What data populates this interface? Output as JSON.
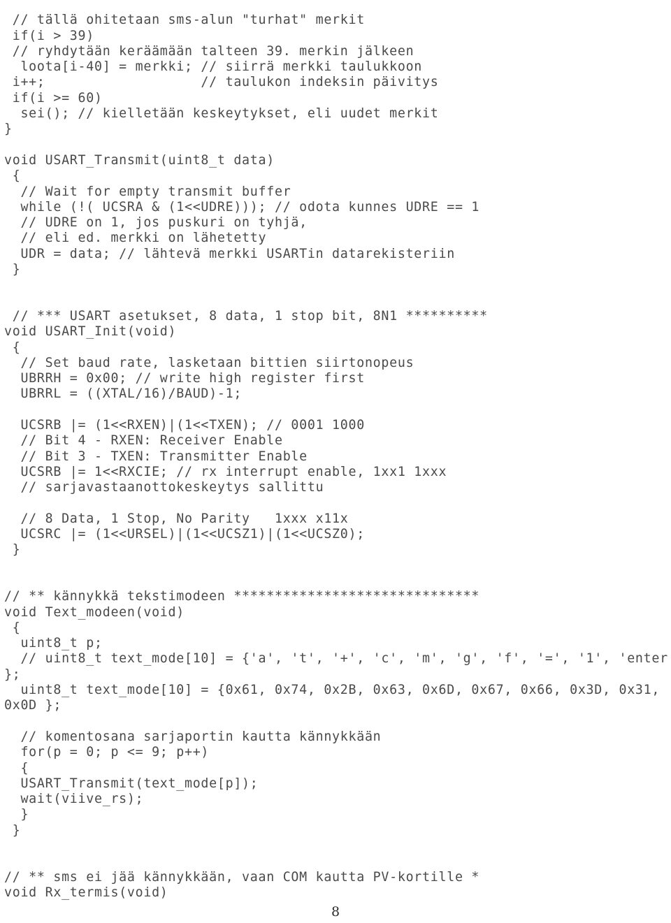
{
  "page": {
    "page_number": "8",
    "text_color": "#4a4a4a",
    "background_color": "#ffffff",
    "language": "c"
  },
  "code": {
    "lines": [
      " // tällä ohitetaan sms-alun \"turhat\" merkit",
      " if(i > 39)",
      " // ryhdytään keräämään talteen 39. merkin jälkeen",
      "  loota[i-40] = merkki; // siirrä merkki taulukkoon",
      " i++;                   // taulukon indeksin päivitys",
      " if(i >= 60)",
      "  sei(); // kielletään keskeytykset, eli uudet merkit",
      "}",
      "",
      "void USART_Transmit(uint8_t data)",
      " {",
      "  // Wait for empty transmit buffer",
      "  while (!( UCSRA & (1<<UDRE))); // odota kunnes UDRE == 1",
      "  // UDRE on 1, jos puskuri on tyhjä,",
      "  // eli ed. merkki on lähetetty",
      "  UDR = data; // lähtevä merkki USARTin datarekisteriin",
      " }",
      "",
      "",
      " // *** USART asetukset, 8 data, 1 stop bit, 8N1 **********",
      "void USART_Init(void)",
      " {",
      "  // Set baud rate, lasketaan bittien siirtonopeus",
      "  UBRRH = 0x00; // write high register first",
      "  UBRRL = ((XTAL/16)/BAUD)-1;",
      "",
      "  UCSRB |= (1<<RXEN)|(1<<TXEN); // 0001 1000",
      "  // Bit 4 - RXEN: Receiver Enable",
      "  // Bit 3 - TXEN: Transmitter Enable",
      "  UCSRB |= 1<<RXCIE; // rx interrupt enable, 1xx1 1xxx",
      "  // sarjavastaanottokeskeytys sallittu",
      "",
      "  // 8 Data, 1 Stop, No Parity   1xxx x11x",
      "  UCSRC |= (1<<URSEL)|(1<<UCSZ1)|(1<<UCSZ0);",
      " }",
      "",
      "",
      "// ** kännykkä tekstimodeen ******************************",
      "void Text_modeen(void)",
      " {",
      "  uint8_t p;",
      "  // uint8_t text_mode[10] = {'a', 't', '+', 'c', 'm', 'g', 'f', '=', '1', 'enter",
      "};",
      "  uint8_t text_mode[10] = {0x61, 0x74, 0x2B, 0x63, 0x6D, 0x67, 0x66, 0x3D, 0x31,",
      "0x0D };",
      "",
      "  // komentosana sarjaportin kautta kännykkään",
      "  for(p = 0; p <= 9; p++)",
      "  {",
      "  USART_Transmit(text_mode[p]);",
      "  wait(viive_rs);",
      "  }",
      " }",
      "",
      "",
      "// ** sms ei jää kännykkään, vaan COM kautta PV-kortille *",
      "void Rx_termis(void)"
    ]
  }
}
